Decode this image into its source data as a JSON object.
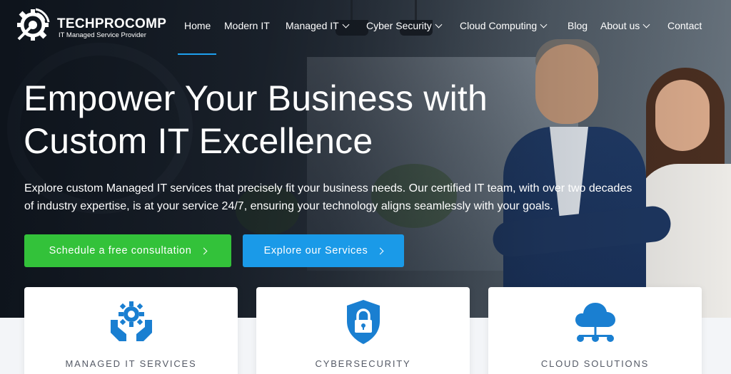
{
  "brand": {
    "name": "TECHPROCOMP",
    "tagline": "IT Managed Service Provider"
  },
  "nav": {
    "items": [
      {
        "label": "Home",
        "active": true,
        "dropdown": false
      },
      {
        "label": "Modern IT",
        "dropdown": false
      },
      {
        "label": "Managed IT",
        "dropdown": true
      },
      {
        "label": "Cyber Security",
        "dropdown": true
      },
      {
        "label": "Cloud Computing",
        "dropdown": true
      },
      {
        "label": "Blog",
        "dropdown": false
      },
      {
        "label": "About us",
        "dropdown": true
      },
      {
        "label": "Contact",
        "dropdown": false
      }
    ]
  },
  "hero": {
    "headline_line1": "Empower Your Business with",
    "headline_line2": "Custom IT Excellence",
    "lead_line1": "Explore custom Managed IT services that precisely fit your business needs. Our certified IT team, with over two decades",
    "lead_line2": "of industry expertise, is at your service 24/7, ensuring your technology aligns seamlessly with your goals.",
    "cta_primary": "Schedule a free consultation",
    "cta_secondary": "Explore our Services"
  },
  "cards": [
    {
      "title": "MANAGED IT SERVICES",
      "icon": "managed-it-gear-hands-icon"
    },
    {
      "title": "CYBERSECURITY",
      "icon": "shield-lock-icon"
    },
    {
      "title": "CLOUD SOLUTIONS",
      "icon": "cloud-network-icon"
    }
  ],
  "colors": {
    "accent_blue": "#1a9ae8",
    "accent_green": "#33c23a",
    "icon_blue": "#1a7fd1"
  }
}
